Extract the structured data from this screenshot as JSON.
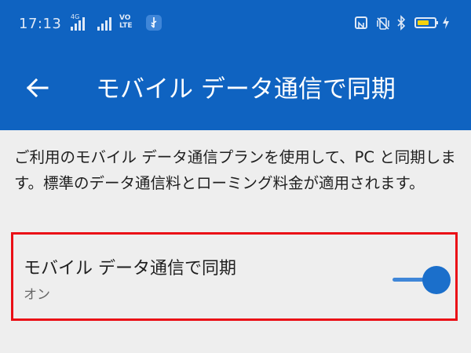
{
  "status_bar": {
    "time": "17:13",
    "network_1": "4G",
    "volte_line1": "VO",
    "volte_line2": "LTE",
    "battery_level": 0.7,
    "colors": {
      "battery": "#f4d20c",
      "accent": "#0f63c1"
    },
    "icons": [
      "signal-icon",
      "usb-icon",
      "nfc-icon",
      "vibrate-icon",
      "bluetooth-icon",
      "battery-icon",
      "charging-icon"
    ]
  },
  "header": {
    "title": "モバイル データ通信で同期",
    "back_icon": "back-arrow-icon"
  },
  "main": {
    "description": "ご利用のモバイル データ通信プランを使用して、PC と同期します。標準のデータ通信料とローミング料金が適用されます。",
    "setting": {
      "title": "モバイル データ通信で同期",
      "state": "オン",
      "enabled": true,
      "highlight_color": "#ea0f16"
    }
  }
}
